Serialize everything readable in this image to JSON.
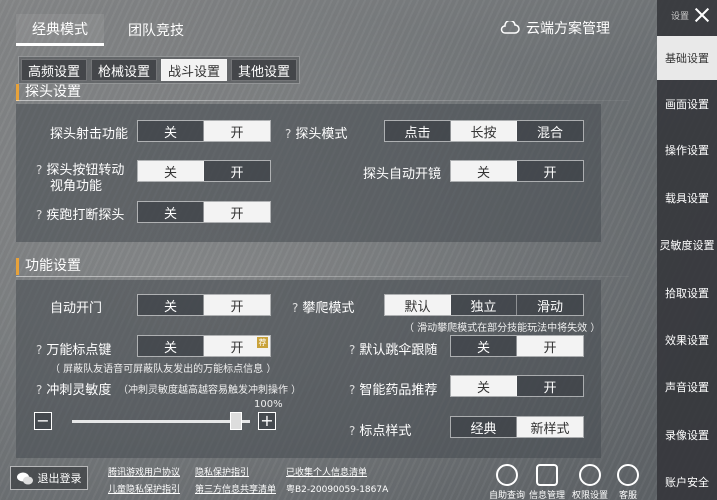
{
  "top_tabs": [
    "经典模式",
    "团队竞技"
  ],
  "cloud_label": "云端方案管理",
  "sub_tabs": [
    "高频设置",
    "枪械设置",
    "战斗设置",
    "其他设置"
  ],
  "sections": {
    "probe_title": "探头设置",
    "function_title": "功能设置"
  },
  "probe": {
    "fire_label": "探头射击功能",
    "fire_options": [
      "关",
      "开"
    ],
    "mode_label": "探头模式",
    "mode_options": [
      "点击",
      "长按",
      "混合"
    ],
    "button_label_1": "探头按钮转动",
    "button_label_2": "视角功能",
    "button_options": [
      "关",
      "开"
    ],
    "auto_scope_label": "探头自动开镜",
    "auto_scope_options": [
      "关",
      "开"
    ],
    "sprint_label": "疾跑打断探头",
    "sprint_options": [
      "关",
      "开"
    ]
  },
  "function": {
    "auto_door_label": "自动开门",
    "auto_door_options": [
      "关",
      "开"
    ],
    "climb_label": "攀爬模式",
    "climb_options": [
      "默认",
      "独立",
      "滑动"
    ],
    "climb_hint": "（ 滑动攀爬模式在部分技能玩法中将失效 ）",
    "mark_label": "万能标点键",
    "mark_options": [
      "关",
      "开"
    ],
    "mark_badge": "荐",
    "mark_hint": "（ 屏蔽队友语音可屏蔽队友发出的万能标点信息 ）",
    "parachute_label": "默认跳伞跟随",
    "parachute_options": [
      "关",
      "开"
    ],
    "sprint_sens_label": "冲刺灵敏度",
    "sprint_sens_hint": "（冲刺灵敏度越高越容易触发冲刺操作 ）",
    "sprint_sens_value": "100%",
    "sprint_sens_fraction": 1.0,
    "minus": "−",
    "plus": "+",
    "medicine_label": "智能药品推荐",
    "medicine_options": [
      "关",
      "开"
    ],
    "marker_style_label": "标点样式",
    "marker_style_options": [
      "经典",
      "新样式"
    ]
  },
  "sidebar": {
    "title": "设置",
    "items": [
      "基础设置",
      "画面设置",
      "操作设置",
      "载具设置",
      "灵敏度设置",
      "拾取设置",
      "效果设置",
      "声音设置",
      "录像设置",
      "账户安全"
    ]
  },
  "footer": {
    "logout": "退出登录",
    "links": [
      "腾讯游戏用户协议",
      "隐私保护指引",
      "已收集个人信息清单",
      "儿童隐私保护指引",
      "第三方信息共享清单",
      "粤B2-20090059-1867A"
    ],
    "icons": [
      "自助查询",
      "信息管理",
      "权限设置",
      "客服"
    ]
  }
}
